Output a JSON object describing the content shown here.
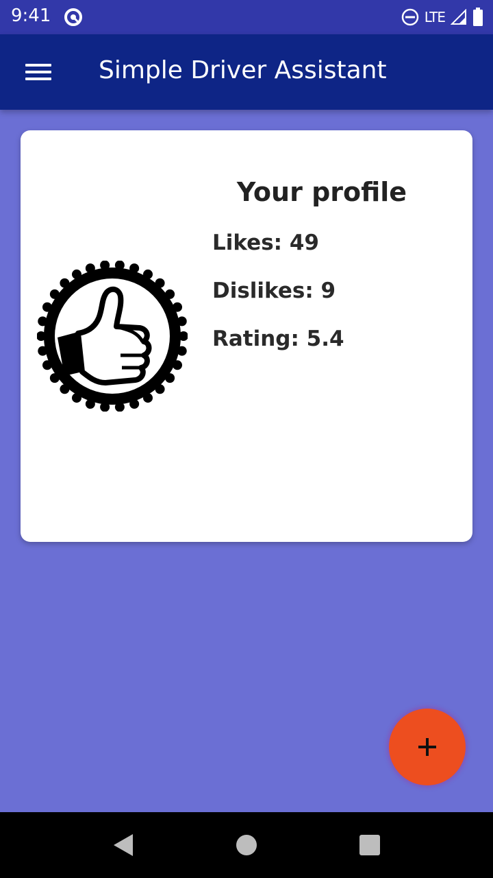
{
  "status_bar": {
    "time": "9:41",
    "network": "LTE",
    "icons": [
      "sync-icon",
      "do-not-disturb-icon",
      "signal-icon",
      "battery-icon"
    ]
  },
  "app_bar": {
    "title": "Simple Driver Assistant",
    "menu_icon": "hamburger-menu-icon",
    "background": "#0e2586"
  },
  "profile": {
    "title": "Your profile",
    "likes_text": "Likes: 49",
    "dislikes_text": "Dislikes: 9",
    "rating_text": "Rating: 5.4",
    "badge_icon": "thumbs-up-badge-icon"
  },
  "fab": {
    "icon": "plus-icon",
    "color": "#ed4e1f"
  },
  "nav_bar": {
    "icons": [
      "back-icon",
      "home-icon",
      "recent-apps-icon"
    ]
  },
  "colors": {
    "screen_background": "#6b6fd4",
    "status_bar": "#3238a9"
  }
}
